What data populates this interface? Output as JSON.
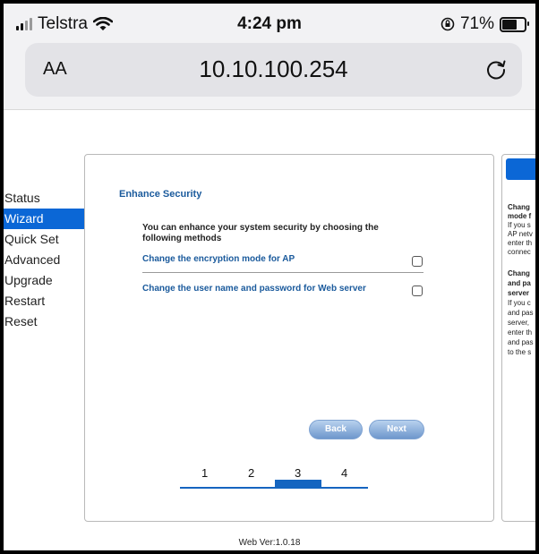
{
  "status_bar": {
    "carrier": "Telstra",
    "time": "4:24 pm",
    "battery": "71%",
    "battery_level": 0.71
  },
  "browser": {
    "text_size_label": "AA",
    "url": "10.10.100.254",
    "reload_icon": "reload-icon"
  },
  "sidebar": {
    "items": [
      {
        "label": "Status"
      },
      {
        "label": "Wizard"
      },
      {
        "label": "Quick Set"
      },
      {
        "label": "Advanced"
      },
      {
        "label": "Upgrade"
      },
      {
        "label": "Restart"
      },
      {
        "label": "Reset"
      }
    ],
    "active": "Wizard"
  },
  "wizard": {
    "title": "Enhance Security",
    "intro": "You can enhance your system security by choosing the following methods",
    "option1": "Change the encryption mode for AP",
    "option2": "Change the user name and password for Web server",
    "back_label": "Back",
    "next_label": "Next",
    "steps": [
      "1",
      "2",
      "3",
      "4"
    ],
    "current_step": "3"
  },
  "help": {
    "lines": [
      "Chang",
      "mode f",
      "If you s",
      "AP netv",
      "enter th",
      "connec",
      "Chang",
      "and pa",
      "server",
      "If you c",
      "and pas",
      "server,",
      "enter th",
      "and pas",
      "to the s"
    ]
  },
  "footer": {
    "version": "Web Ver:1.0.18"
  },
  "colors": {
    "accent": "#0b67d6",
    "link": "#1a5a9c"
  }
}
